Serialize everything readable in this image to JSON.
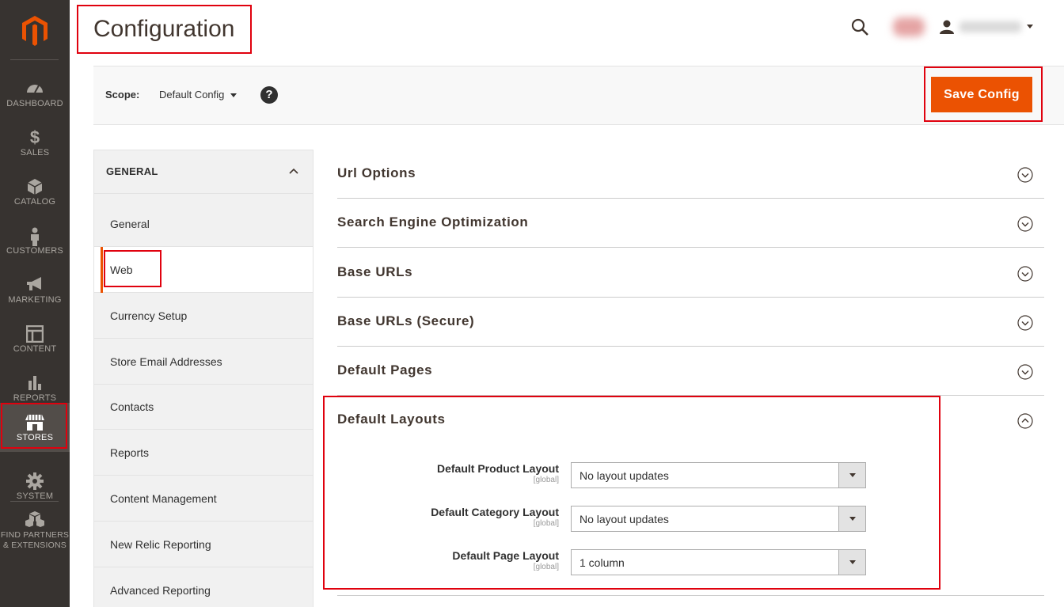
{
  "admin_menu": {
    "items": [
      {
        "label": "DASHBOARD",
        "icon": "dashboard-icon"
      },
      {
        "label": "SALES",
        "icon": "dollar-icon"
      },
      {
        "label": "CATALOG",
        "icon": "cube-icon"
      },
      {
        "label": "CUSTOMERS",
        "icon": "person-icon"
      },
      {
        "label": "MARKETING",
        "icon": "megaphone-icon"
      },
      {
        "label": "CONTENT",
        "icon": "layout-icon"
      },
      {
        "label": "REPORTS",
        "icon": "bar-chart-icon"
      },
      {
        "label": "STORES",
        "icon": "storefront-icon"
      },
      {
        "label": "SYSTEM",
        "icon": "gear-icon"
      },
      {
        "label_line1": "FIND PARTNERS",
        "label_line2": "& EXTENSIONS",
        "icon": "boxes-icon"
      }
    ],
    "active": "STORES"
  },
  "header": {
    "title": "Configuration"
  },
  "scope": {
    "label": "Scope:",
    "value": "Default Config",
    "help": "?"
  },
  "toolbar": {
    "save_label": "Save Config"
  },
  "config_nav": {
    "group_label": "GENERAL",
    "items": [
      {
        "label": "General"
      },
      {
        "label": "Web"
      },
      {
        "label": "Currency Setup"
      },
      {
        "label": "Store Email Addresses"
      },
      {
        "label": "Contacts"
      },
      {
        "label": "Reports"
      },
      {
        "label": "Content Management"
      },
      {
        "label": "New Relic Reporting"
      },
      {
        "label": "Advanced Reporting"
      }
    ],
    "active": "Web"
  },
  "sections": [
    {
      "title": "Url Options",
      "expanded": false
    },
    {
      "title": "Search Engine Optimization",
      "expanded": false
    },
    {
      "title": "Base URLs",
      "expanded": false
    },
    {
      "title": "Base URLs (Secure)",
      "expanded": false
    },
    {
      "title": "Default Pages",
      "expanded": false
    },
    {
      "title": "Default Layouts",
      "expanded": true
    }
  ],
  "default_layouts": {
    "fields": [
      {
        "label": "Default Product Layout",
        "scope": "[global]",
        "value": "No layout updates"
      },
      {
        "label": "Default Category Layout",
        "scope": "[global]",
        "value": "No layout updates"
      },
      {
        "label": "Default Page Layout",
        "scope": "[global]",
        "value": "1 column"
      }
    ]
  },
  "colors": {
    "accent": "#eb5202",
    "highlight": "#e0010e",
    "menu_bg": "#373330"
  }
}
